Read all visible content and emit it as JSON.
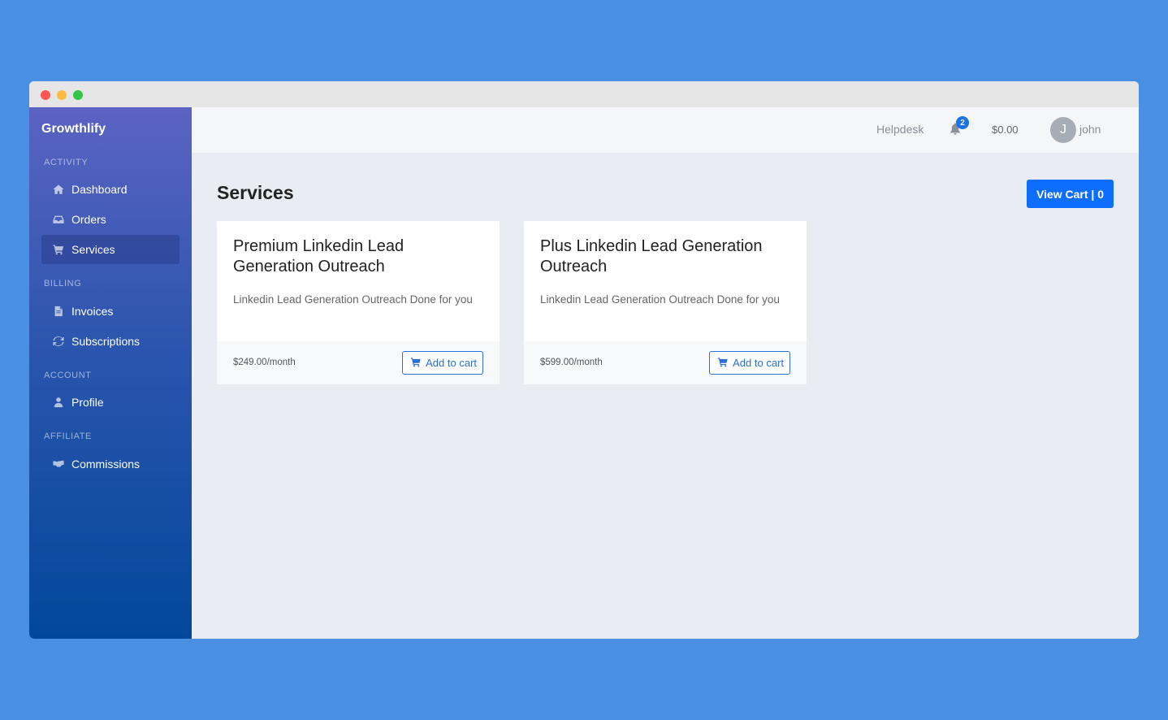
{
  "app": {
    "brand": "Growthlify"
  },
  "sidebar": {
    "sections": [
      {
        "title": "ACTIVITY"
      },
      {
        "title": "BILLING"
      },
      {
        "title": "ACCOUNT"
      },
      {
        "title": "AFFILIATE"
      }
    ],
    "items": [
      {
        "label": "Dashboard",
        "icon": "home-icon"
      },
      {
        "label": "Orders",
        "icon": "inbox-icon"
      },
      {
        "label": "Services",
        "icon": "cart-icon",
        "active": true
      },
      {
        "label": "Invoices",
        "icon": "file-icon"
      },
      {
        "label": "Subscriptions",
        "icon": "refresh-icon"
      },
      {
        "label": "Profile",
        "icon": "user-icon"
      },
      {
        "label": "Commissions",
        "icon": "handshake-icon"
      }
    ]
  },
  "header": {
    "helpdesk": "Helpdesk",
    "notifications_count": "2",
    "balance": "$0.00",
    "avatar_initial": "J",
    "username": "john"
  },
  "main": {
    "title": "Services",
    "view_cart": "View Cart | 0",
    "cards": [
      {
        "title": "Premium Linkedin Lead Generation Outreach",
        "description": "Linkedin Lead Generation Outreach Done for you",
        "price": "$249.00/month",
        "button": "Add to cart"
      },
      {
        "title": "Plus Linkedin Lead Generation Outreach",
        "description": "Linkedin Lead Generation Outreach Done for you",
        "price": "$599.00/month",
        "button": "Add to cart"
      }
    ]
  },
  "colors": {
    "background": "#4a90e2",
    "primary": "#0d6efd",
    "sidebar_top": "#5b63c2",
    "sidebar_bottom": "#02489a"
  }
}
